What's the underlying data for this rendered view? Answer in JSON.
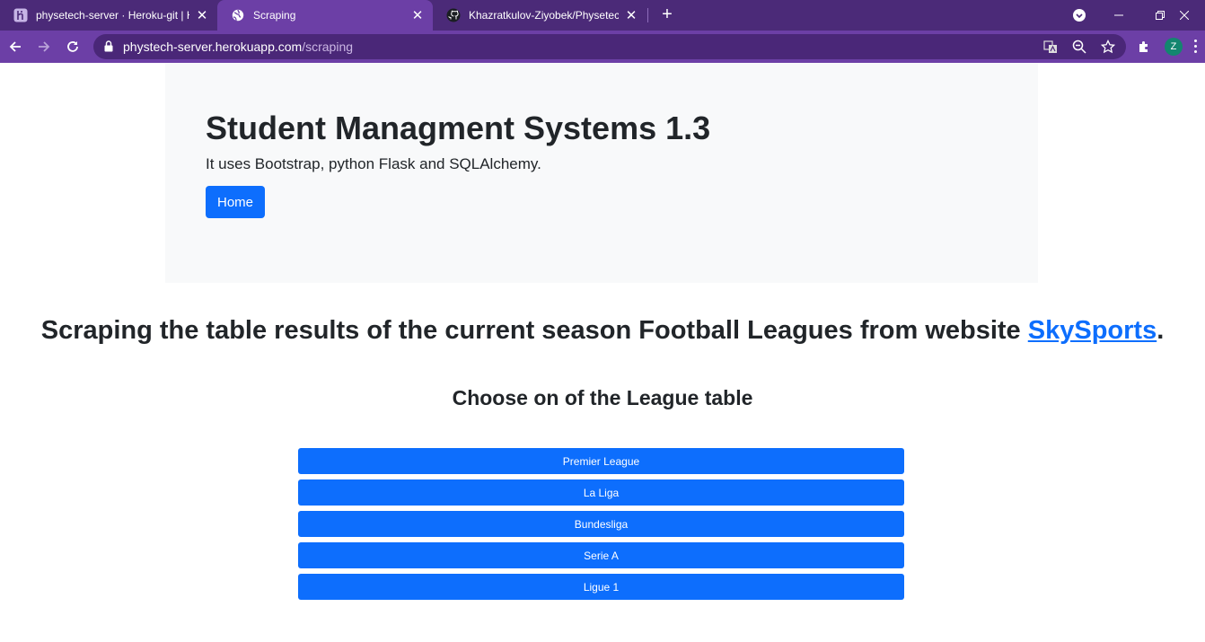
{
  "browser": {
    "tabs": [
      {
        "title": "physetech-server · Heroku-git | He",
        "icon": "heroku-icon",
        "active": false
      },
      {
        "title": "Scraping",
        "icon": "globe-icon",
        "active": true
      },
      {
        "title": "Khazratkulov-Ziyobek/Physetech-s",
        "icon": "github-icon",
        "active": false
      }
    ],
    "url_host": "phystech-server.herokuapp.com",
    "url_path": "/scraping",
    "profile_initial": "Z",
    "theme_color": "#6c3fa6"
  },
  "page": {
    "header": {
      "title": "Student Managment Systems 1.3",
      "lead": "It uses Bootstrap, python Flask and SQLAlchemy.",
      "home_label": "Home"
    },
    "section": {
      "title_prefix": "Scraping the table results of the current season Football Leagues from website ",
      "link_text": "SkySports",
      "title_suffix": "."
    },
    "choose_title": "Choose on of the League table",
    "leagues": [
      "Premier League",
      "La Liga",
      "Bundesliga",
      "Serie A",
      "Ligue 1"
    ],
    "accent_color": "#0d6efd"
  }
}
